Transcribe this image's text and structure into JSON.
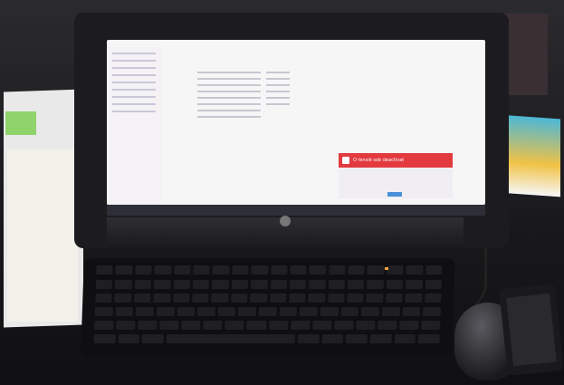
{
  "photo": {
    "subject": "desktop computer on desk with keyboard and mouse",
    "screen": {
      "window": "file explorer",
      "notification_title": "O tensiё sob deactivat"
    },
    "colors": {
      "notification": "#e23a3f",
      "screen": "#f7f6f7",
      "bezel": "#1c1c20",
      "desk": "#121215"
    }
  }
}
